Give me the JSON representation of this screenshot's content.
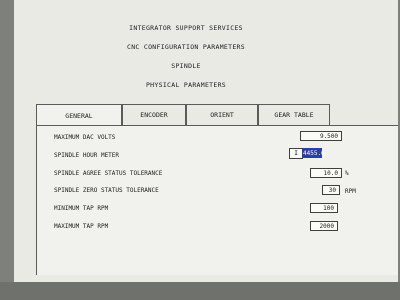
{
  "header": {
    "line1": "INTEGRATOR SUPPORT SERVICES",
    "line2": "CNC CONFIGURATION PARAMETERS",
    "line3": "SPINDLE",
    "line4": "PHYSICAL PARAMETERS"
  },
  "tabs": [
    {
      "label": "GENERAL",
      "active": true
    },
    {
      "label": "ENCODER",
      "active": false
    },
    {
      "label": "ORIENT",
      "active": false
    },
    {
      "label": "GEAR TABLE",
      "active": false
    }
  ],
  "params": [
    {
      "label": "MAXIMUM DAC VOLTS",
      "value": "9.500",
      "unit": ""
    },
    {
      "label": "SPINDLE HOUR METER",
      "value": "4455.6",
      "unit": "",
      "cursor": "I"
    },
    {
      "label": "SPINDLE AGREE STATUS TOLERANCE",
      "value": "10.0",
      "unit": "%"
    },
    {
      "label": "SPINDLE ZERO STATUS TOLERANCE",
      "value": "30",
      "unit": "RPM"
    },
    {
      "label": "MINIMUM TAP RPM",
      "value": "100",
      "unit": ""
    },
    {
      "label": "MAXIMUM TAP RPM",
      "value": "2000",
      "unit": ""
    }
  ],
  "colors": {
    "screen_bg": "#e9eae4",
    "selection": "#2b3fa3"
  }
}
